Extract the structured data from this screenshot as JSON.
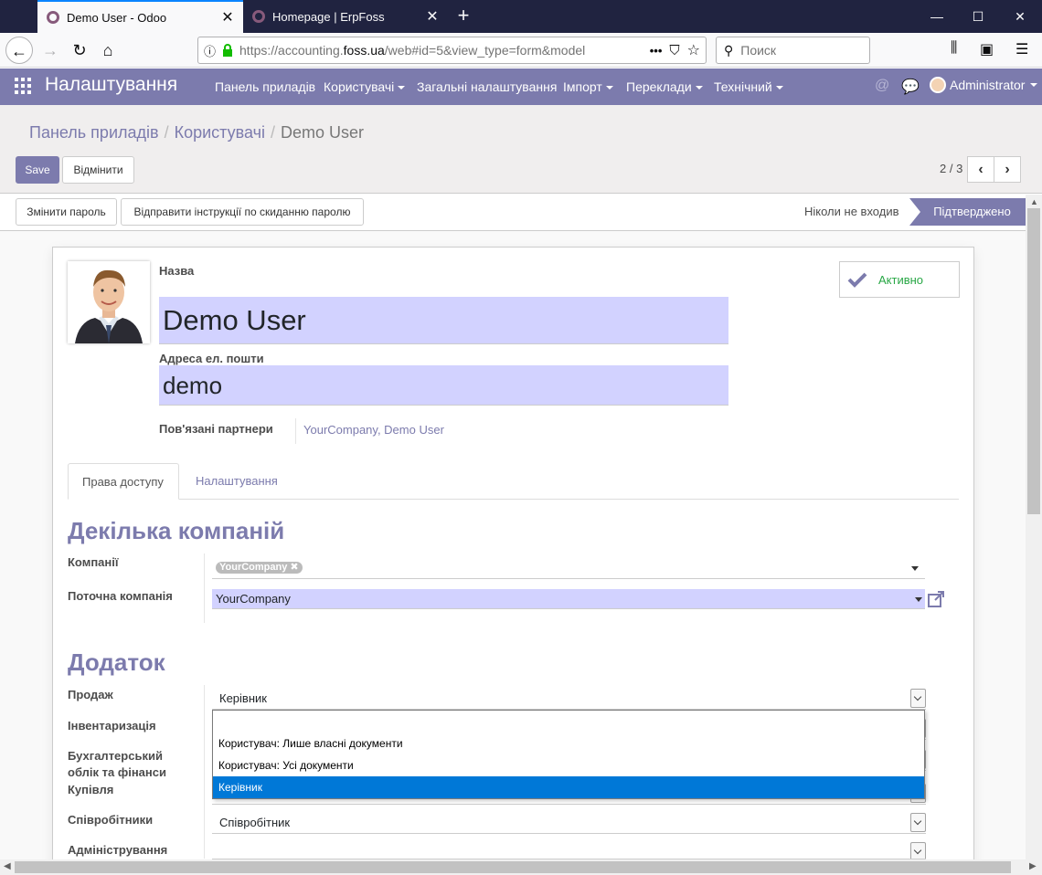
{
  "browser": {
    "tabs": [
      {
        "title": "Demo User - Odoo",
        "active": true
      },
      {
        "title": "Homepage | ErpFoss",
        "active": false
      }
    ],
    "url_prefix": "https://accounting.",
    "url_domain": "foss.ua",
    "url_suffix": "/web#id=5&view_type=form&model",
    "url_more": "•••",
    "search_placeholder": "Поиск"
  },
  "odoo_nav": {
    "brand": "Налаштування",
    "menu": [
      {
        "label": "Панель приладів",
        "dropdown": false
      },
      {
        "label": "Користувачі",
        "dropdown": true
      },
      {
        "label": "Загальні налаштування",
        "dropdown": false
      },
      {
        "label": "Імпорт",
        "dropdown": true
      },
      {
        "label": "Переклади",
        "dropdown": true
      },
      {
        "label": "Технічний",
        "dropdown": true
      }
    ],
    "user": "Administrator"
  },
  "breadcrumb": {
    "items": [
      "Панель приладів",
      "Користувачі"
    ],
    "current": "Demo User"
  },
  "buttons": {
    "save": "Save",
    "discard": "Відмінити",
    "change_password": "Змінити пароль",
    "send_reset": "Відправити інструкції по скиданню паролю"
  },
  "pager": {
    "value": "2 / 3"
  },
  "statusbar": {
    "stages": [
      "Ніколи не входив",
      "Підтверджено"
    ],
    "current": "Підтверджено"
  },
  "form": {
    "name_label": "Назва",
    "name_value": "Demo User",
    "email_label": "Адреса ел. пошти",
    "email_value": "demo",
    "partners_label": "Пов'язані партнери",
    "partners_value": "YourCompany, Demo User",
    "active_label": "Активно"
  },
  "tabs": [
    {
      "label": "Права доступу",
      "active": true
    },
    {
      "label": "Налаштування",
      "active": false
    }
  ],
  "multi_company": {
    "title": "Декілька компаній",
    "companies_label": "Компанії",
    "companies_tags": [
      "YourCompany"
    ],
    "current_label": "Поточна компанія",
    "current_value": "YourCompany"
  },
  "application": {
    "title": "Додаток",
    "fields": [
      {
        "label": "Продаж",
        "value": "Керівник"
      },
      {
        "label": "Інвентаризація",
        "value": ""
      },
      {
        "label": "Бухгалтерський облік та фінанси",
        "value": ""
      },
      {
        "label": "Купівля",
        "value": ""
      },
      {
        "label": "Співробітники",
        "value": "Співробітник"
      },
      {
        "label": "Адміністрування",
        "value": ""
      }
    ]
  },
  "dropdown_options": [
    {
      "label": "",
      "selected": false
    },
    {
      "label": "Користувач: Лише власні документи",
      "selected": false
    },
    {
      "label": "Користувач: Усі документи",
      "selected": false
    },
    {
      "label": "Керівник",
      "selected": true
    }
  ],
  "colors": {
    "brand": "#7c7bad",
    "field_required_bg": "#d2d2ff",
    "active_green": "#28a745",
    "select_highlight": "#0078d7"
  }
}
